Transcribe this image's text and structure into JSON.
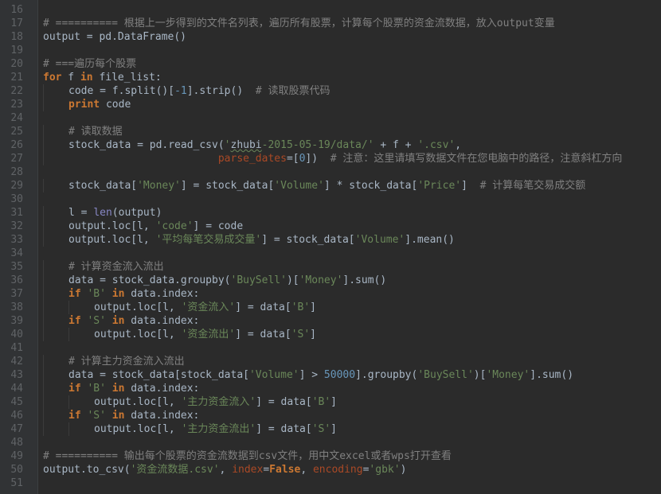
{
  "gutter": {
    "line_numbers": [
      "16",
      "17",
      "18",
      "19",
      "20",
      "21",
      "22",
      "23",
      "24",
      "25",
      "26",
      "27",
      "28",
      "29",
      "30",
      "31",
      "32",
      "33",
      "34",
      "35",
      "36",
      "37",
      "38",
      "39",
      "40",
      "41",
      "42",
      "43",
      "44",
      "45",
      "46",
      "47",
      "48",
      "49",
      "50",
      "51"
    ]
  },
  "colors": {
    "background": "#2b2b2b",
    "keyword": "#cc7832",
    "string": "#6a8759",
    "number": "#6897bb",
    "comment": "#808080",
    "param": "#aa4926",
    "builtin": "#8888c6",
    "text": "#a9b7c6"
  },
  "lines": [
    [],
    [
      {
        "t": "cm",
        "v": "# ========== 根据上一步得到的文件名列表，遍历所有股票，计算每个股票的资金流数据，放入output变量"
      }
    ],
    [
      {
        "t": "df",
        "v": "output = pd.DataFrame()"
      }
    ],
    [],
    [
      {
        "t": "cm",
        "v": "# ===遍历每个股票"
      }
    ],
    [
      {
        "t": "kw",
        "v": "for"
      },
      {
        "t": "df",
        "v": " f "
      },
      {
        "t": "kw",
        "v": "in"
      },
      {
        "t": "df",
        "v": " file_list:"
      }
    ],
    [
      {
        "t": "i1"
      },
      {
        "t": "df",
        "v": "code = f.split()["
      },
      {
        "t": "nm",
        "v": "-1"
      },
      {
        "t": "df",
        "v": "].strip()  "
      },
      {
        "t": "cm",
        "v": "# 读取股票代码"
      }
    ],
    [
      {
        "t": "i1"
      },
      {
        "t": "kw",
        "v": "print"
      },
      {
        "t": "df",
        "v": " code"
      }
    ],
    [],
    [
      {
        "t": "i1"
      },
      {
        "t": "cm",
        "v": "# 读取数据"
      }
    ],
    [
      {
        "t": "i1"
      },
      {
        "t": "df",
        "v": "stock_data = pd.read_csv("
      },
      {
        "t": "st",
        "v": "'"
      },
      {
        "t": "sq",
        "v": "zhubi"
      },
      {
        "t": "st",
        "v": "-2015-05-19/data/'"
      },
      {
        "t": "df",
        "v": " + f + "
      },
      {
        "t": "st",
        "v": "'.csv'"
      },
      {
        "t": "df",
        "v": ","
      }
    ],
    [
      {
        "t": "i1"
      },
      {
        "t": "df",
        "v": "                        "
      },
      {
        "t": "pr",
        "v": "parse_dates"
      },
      {
        "t": "df",
        "v": "=["
      },
      {
        "t": "nm",
        "v": "0"
      },
      {
        "t": "df",
        "v": "])  "
      },
      {
        "t": "cm",
        "v": "# 注意：这里请填写数据文件在您电脑中的路径，注意斜杠方向"
      }
    ],
    [],
    [
      {
        "t": "i1"
      },
      {
        "t": "df",
        "v": "stock_data["
      },
      {
        "t": "st",
        "v": "'Money'"
      },
      {
        "t": "df",
        "v": "] = stock_data["
      },
      {
        "t": "st",
        "v": "'Volume'"
      },
      {
        "t": "df",
        "v": "] * stock_data["
      },
      {
        "t": "st",
        "v": "'Price'"
      },
      {
        "t": "df",
        "v": "]  "
      },
      {
        "t": "cm",
        "v": "# 计算每笔交易成交额"
      }
    ],
    [],
    [
      {
        "t": "i1"
      },
      {
        "t": "df",
        "v": "l = "
      },
      {
        "t": "bi",
        "v": "len"
      },
      {
        "t": "df",
        "v": "(output)"
      }
    ],
    [
      {
        "t": "i1"
      },
      {
        "t": "df",
        "v": "output.loc[l, "
      },
      {
        "t": "st",
        "v": "'code'"
      },
      {
        "t": "df",
        "v": "] = code"
      }
    ],
    [
      {
        "t": "i1"
      },
      {
        "t": "df",
        "v": "output.loc[l, "
      },
      {
        "t": "st",
        "v": "'平均每笔交易成交量'"
      },
      {
        "t": "df",
        "v": "] = stock_data["
      },
      {
        "t": "st",
        "v": "'Volume'"
      },
      {
        "t": "df",
        "v": "].mean()"
      }
    ],
    [],
    [
      {
        "t": "i1"
      },
      {
        "t": "cm",
        "v": "# 计算资金流入流出"
      }
    ],
    [
      {
        "t": "i1"
      },
      {
        "t": "df",
        "v": "data = stock_data.groupby("
      },
      {
        "t": "st",
        "v": "'BuySell'"
      },
      {
        "t": "df",
        "v": ")["
      },
      {
        "t": "st",
        "v": "'Money'"
      },
      {
        "t": "df",
        "v": "].sum()"
      }
    ],
    [
      {
        "t": "i1"
      },
      {
        "t": "kw",
        "v": "if"
      },
      {
        "t": "df",
        "v": " "
      },
      {
        "t": "st",
        "v": "'B'"
      },
      {
        "t": "df",
        "v": " "
      },
      {
        "t": "kw",
        "v": "in"
      },
      {
        "t": "df",
        "v": " data.index:"
      }
    ],
    [
      {
        "t": "i2"
      },
      {
        "t": "df",
        "v": "output.loc[l, "
      },
      {
        "t": "st",
        "v": "'资金流入'"
      },
      {
        "t": "df",
        "v": "] = data["
      },
      {
        "t": "st",
        "v": "'B'"
      },
      {
        "t": "df",
        "v": "]"
      }
    ],
    [
      {
        "t": "i1"
      },
      {
        "t": "kw",
        "v": "if"
      },
      {
        "t": "df",
        "v": " "
      },
      {
        "t": "st",
        "v": "'S'"
      },
      {
        "t": "df",
        "v": " "
      },
      {
        "t": "kw",
        "v": "in"
      },
      {
        "t": "df",
        "v": " data.index:"
      }
    ],
    [
      {
        "t": "i2"
      },
      {
        "t": "df",
        "v": "output.loc[l, "
      },
      {
        "t": "st",
        "v": "'资金流出'"
      },
      {
        "t": "df",
        "v": "] = data["
      },
      {
        "t": "st",
        "v": "'S'"
      },
      {
        "t": "df",
        "v": "]"
      }
    ],
    [],
    [
      {
        "t": "i1"
      },
      {
        "t": "cm",
        "v": "# 计算主力资金流入流出"
      }
    ],
    [
      {
        "t": "i1"
      },
      {
        "t": "df",
        "v": "data = stock_data[stock_data["
      },
      {
        "t": "st",
        "v": "'Volume'"
      },
      {
        "t": "df",
        "v": "] > "
      },
      {
        "t": "nm",
        "v": "50000"
      },
      {
        "t": "df",
        "v": "].groupby("
      },
      {
        "t": "st",
        "v": "'BuySell'"
      },
      {
        "t": "df",
        "v": ")["
      },
      {
        "t": "st",
        "v": "'Money'"
      },
      {
        "t": "df",
        "v": "].sum()"
      }
    ],
    [
      {
        "t": "i1"
      },
      {
        "t": "kw",
        "v": "if"
      },
      {
        "t": "df",
        "v": " "
      },
      {
        "t": "st",
        "v": "'B'"
      },
      {
        "t": "df",
        "v": " "
      },
      {
        "t": "kw",
        "v": "in"
      },
      {
        "t": "df",
        "v": " data.index:"
      }
    ],
    [
      {
        "t": "i2"
      },
      {
        "t": "df",
        "v": "output.loc[l, "
      },
      {
        "t": "st",
        "v": "'主力资金流入'"
      },
      {
        "t": "df",
        "v": "] = data["
      },
      {
        "t": "st",
        "v": "'B'"
      },
      {
        "t": "df",
        "v": "]"
      }
    ],
    [
      {
        "t": "i1"
      },
      {
        "t": "kw",
        "v": "if"
      },
      {
        "t": "df",
        "v": " "
      },
      {
        "t": "st",
        "v": "'S'"
      },
      {
        "t": "df",
        "v": " "
      },
      {
        "t": "kw",
        "v": "in"
      },
      {
        "t": "df",
        "v": " data.index:"
      }
    ],
    [
      {
        "t": "i2"
      },
      {
        "t": "df",
        "v": "output.loc[l, "
      },
      {
        "t": "st",
        "v": "'主力资金流出'"
      },
      {
        "t": "df",
        "v": "] = data["
      },
      {
        "t": "st",
        "v": "'S'"
      },
      {
        "t": "df",
        "v": "]"
      }
    ],
    [],
    [
      {
        "t": "cm",
        "v": "# ========== 输出每个股票的资金流数据到csv文件，用中文excel或者wps打开查看"
      }
    ],
    [
      {
        "t": "df",
        "v": "output.to_csv("
      },
      {
        "t": "st",
        "v": "'资金流数据.csv'"
      },
      {
        "t": "df",
        "v": ", "
      },
      {
        "t": "pr",
        "v": "index"
      },
      {
        "t": "df",
        "v": "="
      },
      {
        "t": "kw",
        "v": "False"
      },
      {
        "t": "df",
        "v": ", "
      },
      {
        "t": "pr",
        "v": "encoding"
      },
      {
        "t": "df",
        "v": "="
      },
      {
        "t": "st",
        "v": "'gbk'"
      },
      {
        "t": "df",
        "v": ")"
      }
    ],
    []
  ]
}
